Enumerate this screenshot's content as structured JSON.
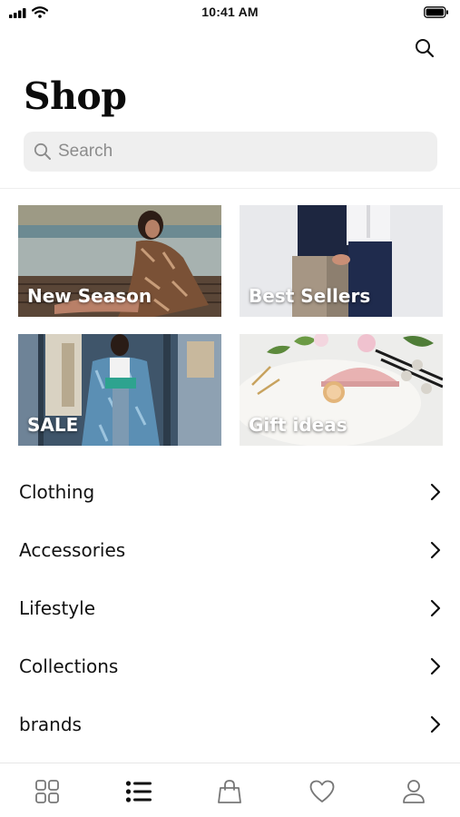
{
  "status_bar": {
    "time": "10:41 AM"
  },
  "header": {
    "title": "Shop"
  },
  "search": {
    "placeholder": "Search",
    "value": ""
  },
  "tiles": [
    {
      "label": "New Season"
    },
    {
      "label": "Best Sellers"
    },
    {
      "label": "SALE"
    },
    {
      "label": "Gift ideas"
    }
  ],
  "categories": [
    {
      "label": "Clothing"
    },
    {
      "label": "Accessories"
    },
    {
      "label": "Lifestyle"
    },
    {
      "label": "Collections"
    },
    {
      "label": "brands"
    }
  ],
  "tab_bar": {
    "active": "list",
    "tabs": [
      "grid-icon",
      "list-icon",
      "bag-icon",
      "heart-icon",
      "user-icon"
    ]
  },
  "colors": {
    "text": "#111111",
    "search_bg": "#efefef",
    "inactive_icon": "#777777",
    "active_icon": "#111111"
  }
}
